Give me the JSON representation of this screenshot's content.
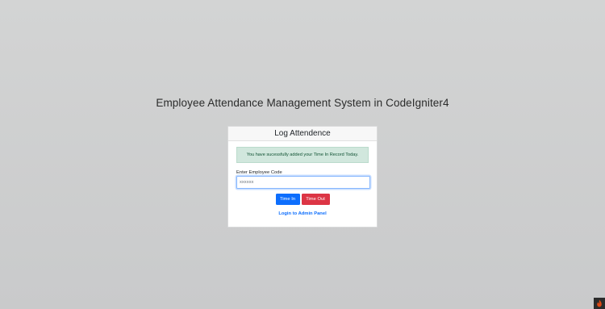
{
  "page": {
    "title": "Employee Attendance Management System in CodeIgniter4"
  },
  "card": {
    "header": "Log Attendence",
    "alert_message": "You have sucessfully added your Time In Record Today.",
    "employee_code_label": "Enter Employee Code",
    "employee_code_value": "",
    "employee_code_placeholder": "xxxxxx",
    "time_in_label": "Time In",
    "time_out_label": "Time Out",
    "admin_link_label": "Login to Admin Panel"
  },
  "colors": {
    "primary": "#0d6efd",
    "danger": "#dc3545",
    "success_bg": "#d1e7dd",
    "success_text": "#0f5132"
  },
  "icons": {
    "corner": "flame-icon"
  }
}
